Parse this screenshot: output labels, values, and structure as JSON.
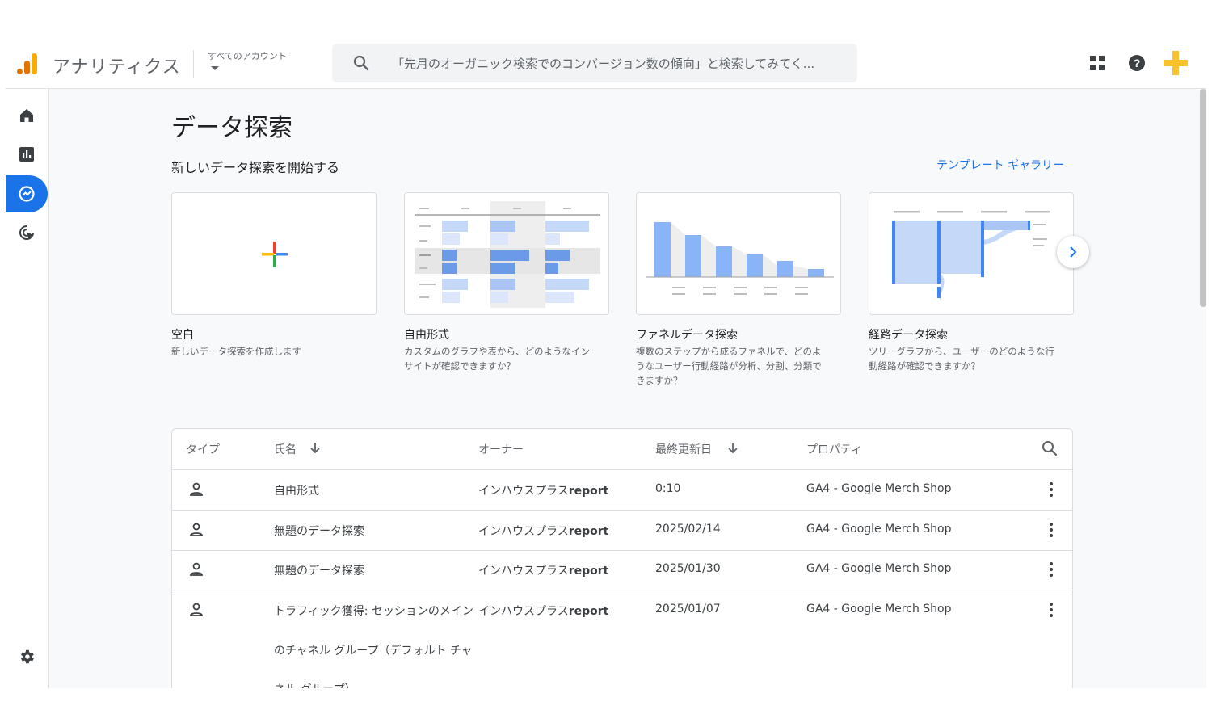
{
  "header": {
    "app_title": "アナリティクス",
    "account_label": "すべてのアカウント",
    "search_placeholder": "「先月のオーガニック検索でのコンバージョン数の傾向」と検索してみてく..."
  },
  "sidebar": {
    "items": [
      {
        "name": "home",
        "icon": "home-icon",
        "active": false
      },
      {
        "name": "reports",
        "icon": "bar-chart-icon",
        "active": false
      },
      {
        "name": "explore",
        "icon": "explore-icon",
        "active": true
      },
      {
        "name": "advertising",
        "icon": "target-cursor-icon",
        "active": false
      }
    ],
    "settings_icon": "gear-icon",
    "accent": "#1a73e8"
  },
  "main": {
    "title": "データ探索",
    "section_title": "新しいデータ探索を開始する",
    "gallery_link": "テンプレート ギャラリー",
    "templates": [
      {
        "name": "空白",
        "desc1": "新しいデータ探索を作成します",
        "desc2": "",
        "desc3": ""
      },
      {
        "name": "自由形式",
        "desc1": "カスタムのグラフや表から、どのようなイン",
        "desc2": "サイトが確認できますか？",
        "desc3": ""
      },
      {
        "name": "ファネルデータ探索",
        "desc1": "複数のステップから成るファネルで、どのよ",
        "desc2": "うなユーザー行動経路が分析、分割、分類で",
        "desc3": "きますか？"
      },
      {
        "name": "経路データ探索",
        "desc1": "ツリーグラフから、ユーザーのどのような行",
        "desc2": "動経路が確認できますか？",
        "desc3": ""
      }
    ]
  },
  "table": {
    "headers": {
      "type": "タイプ",
      "name": "氏名",
      "owner": "オーナー",
      "updated": "最終更新日",
      "property": "プロパティ"
    },
    "rows": [
      {
        "name": "自由形式",
        "owner_prefix": "インハウスプラス",
        "owner_suffix": "report",
        "updated": "0:10",
        "property": "GA4 - Google Merch Shop"
      },
      {
        "name": "無題のデータ探索",
        "owner_prefix": "インハウスプラス",
        "owner_suffix": "report",
        "updated": "2025/02/14",
        "property": "GA4 - Google Merch Shop"
      },
      {
        "name": "無題のデータ探索",
        "owner_prefix": "インハウスプラス",
        "owner_suffix": "report",
        "updated": "2025/01/30",
        "property": "GA4 - Google Merch Shop"
      },
      {
        "name_line1": "トラフィック獲得: セッションのメイン",
        "name_line2": "のチャネル グループ（デフォルト チャ",
        "name_line3": "ネル グループ）",
        "owner_prefix": "インハウスプラス",
        "owner_suffix": "report",
        "updated": "2025/01/07",
        "property": "GA4 - Google Merch Shop"
      }
    ]
  }
}
